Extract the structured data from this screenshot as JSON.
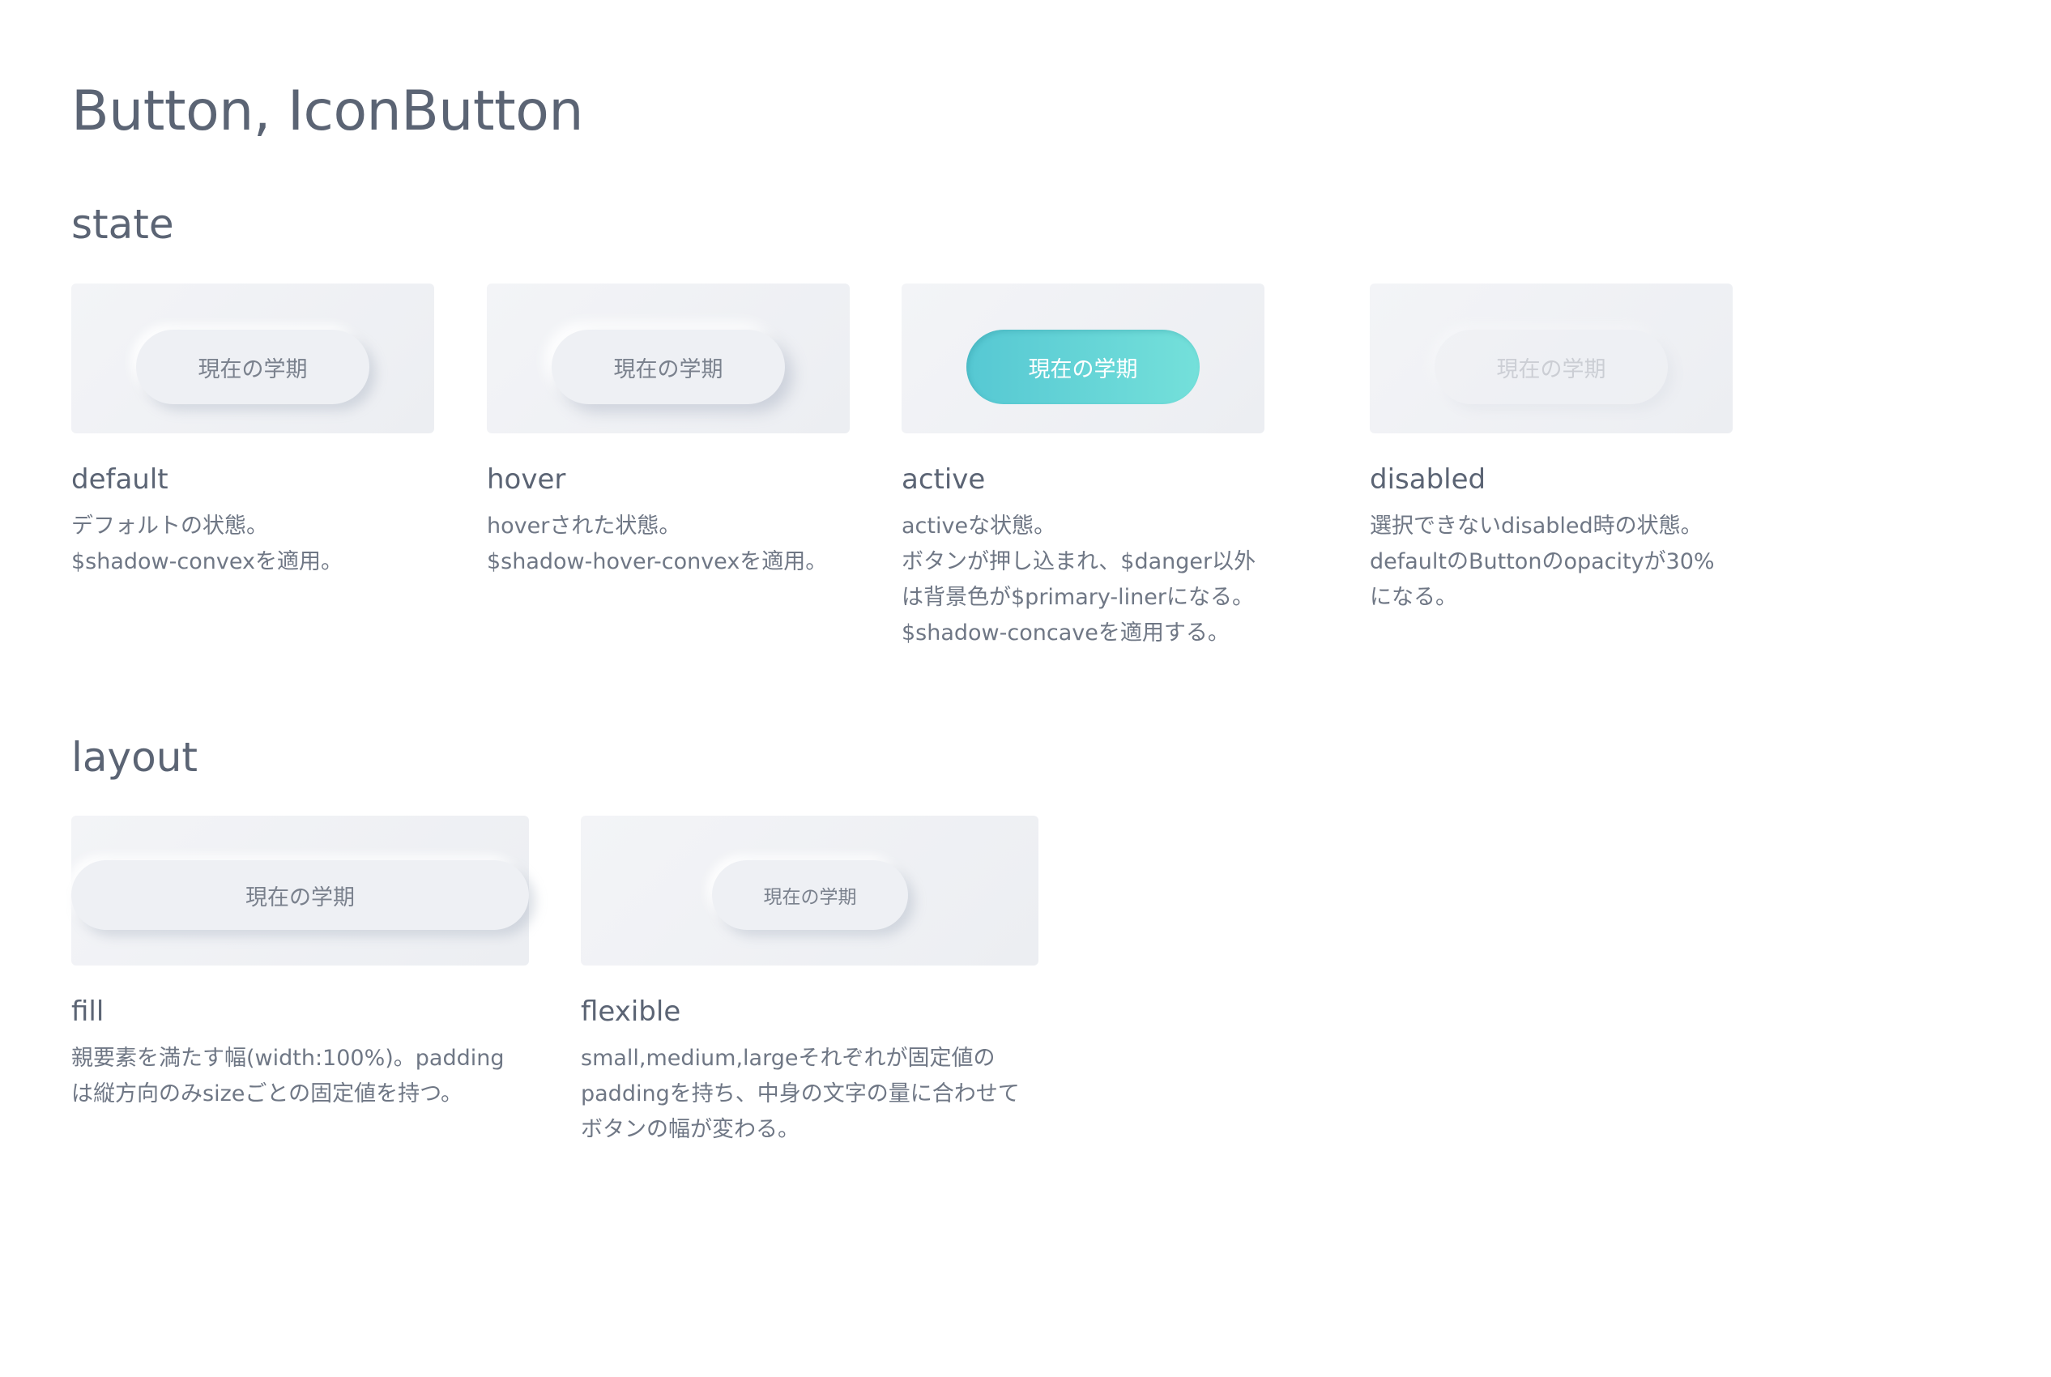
{
  "page": {
    "title": "Button, IconButton"
  },
  "colors": {
    "background": "#ffffff",
    "panel": "#eef0f4",
    "text": "#5b6474",
    "primary_liner_start": "#56c8d3",
    "primary_liner_end": "#74e0da"
  },
  "state_section": {
    "title": "state",
    "cards": [
      {
        "button_label": "現在の学期",
        "title": "default",
        "description": "デフォルトの状態。\n$shadow-convexを適用。"
      },
      {
        "button_label": "現在の学期",
        "title": "hover",
        "description": "hoverされた状態。\n$shadow-hover-convexを適用。"
      },
      {
        "button_label": "現在の学期",
        "title": "active",
        "description": "activeな状態。\nボタンが押し込まれ、$danger以外\nは背景色が$primary-linerになる。\n$shadow-concaveを適用する。"
      },
      {
        "button_label": "現在の学期",
        "title": "disabled",
        "description": "選択できないdisabled時の状態。\ndefaultのButtonのopacityが30%\nになる。"
      }
    ]
  },
  "layout_section": {
    "title": "layout",
    "cards": [
      {
        "button_label": "現在の学期",
        "title": "fill",
        "description": "親要素を満たす幅(width:100%)。padding\nは縦方向のみsizeごとの固定値を持つ。"
      },
      {
        "button_label": "現在の学期",
        "title": "flexible",
        "description": "small,medium,largeそれぞれが固定値の\npaddingを持ち、中身の文字の量に合わせて\nボタンの幅が変わる。"
      }
    ]
  }
}
